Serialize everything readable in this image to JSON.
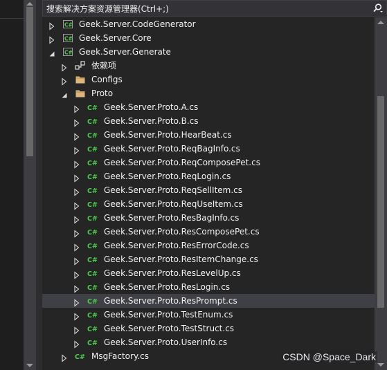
{
  "search": {
    "placeholder": "搜索解决方案资源管理器(Ctrl+;)"
  },
  "tree": [
    {
      "label": "Geek.Server.CodeGenerator",
      "icon": "csharp-project-icon",
      "level": 0,
      "expander": "collapsed"
    },
    {
      "label": "Geek.Server.Core",
      "icon": "csharp-project-icon",
      "level": 0,
      "expander": "collapsed"
    },
    {
      "label": "Geek.Server.Generate",
      "icon": "csharp-project-icon",
      "level": 0,
      "expander": "expanded"
    },
    {
      "label": "依赖项",
      "icon": "dependencies-icon",
      "level": 1,
      "expander": "collapsed"
    },
    {
      "label": "Configs",
      "icon": "folder-icon",
      "level": 1,
      "expander": "collapsed"
    },
    {
      "label": "Proto",
      "icon": "folder-icon",
      "level": 1,
      "expander": "expanded"
    },
    {
      "label": "Geek.Server.Proto.A.cs",
      "icon": "csharp-file-icon",
      "level": 2,
      "expander": "collapsed"
    },
    {
      "label": "Geek.Server.Proto.B.cs",
      "icon": "csharp-file-icon",
      "level": 2,
      "expander": "collapsed"
    },
    {
      "label": "Geek.Server.Proto.HearBeat.cs",
      "icon": "csharp-file-icon",
      "level": 2,
      "expander": "collapsed"
    },
    {
      "label": "Geek.Server.Proto.ReqBagInfo.cs",
      "icon": "csharp-file-icon",
      "level": 2,
      "expander": "collapsed"
    },
    {
      "label": "Geek.Server.Proto.ReqComposePet.cs",
      "icon": "csharp-file-icon",
      "level": 2,
      "expander": "collapsed"
    },
    {
      "label": "Geek.Server.Proto.ReqLogin.cs",
      "icon": "csharp-file-icon",
      "level": 2,
      "expander": "collapsed"
    },
    {
      "label": "Geek.Server.Proto.ReqSellItem.cs",
      "icon": "csharp-file-icon",
      "level": 2,
      "expander": "collapsed"
    },
    {
      "label": "Geek.Server.Proto.ReqUseItem.cs",
      "icon": "csharp-file-icon",
      "level": 2,
      "expander": "collapsed"
    },
    {
      "label": "Geek.Server.Proto.ResBagInfo.cs",
      "icon": "csharp-file-icon",
      "level": 2,
      "expander": "collapsed"
    },
    {
      "label": "Geek.Server.Proto.ResComposePet.cs",
      "icon": "csharp-file-icon",
      "level": 2,
      "expander": "collapsed"
    },
    {
      "label": "Geek.Server.Proto.ResErrorCode.cs",
      "icon": "csharp-file-icon",
      "level": 2,
      "expander": "collapsed"
    },
    {
      "label": "Geek.Server.Proto.ResItemChange.cs",
      "icon": "csharp-file-icon",
      "level": 2,
      "expander": "collapsed"
    },
    {
      "label": "Geek.Server.Proto.ResLevelUp.cs",
      "icon": "csharp-file-icon",
      "level": 2,
      "expander": "collapsed"
    },
    {
      "label": "Geek.Server.Proto.ResLogin.cs",
      "icon": "csharp-file-icon",
      "level": 2,
      "expander": "collapsed"
    },
    {
      "label": "Geek.Server.Proto.ResPrompt.cs",
      "icon": "csharp-file-icon",
      "level": 2,
      "expander": "collapsed",
      "selected": true
    },
    {
      "label": "Geek.Server.Proto.TestEnum.cs",
      "icon": "csharp-file-icon",
      "level": 2,
      "expander": "collapsed"
    },
    {
      "label": "Geek.Server.Proto.TestStruct.cs",
      "icon": "csharp-file-icon",
      "level": 2,
      "expander": "collapsed"
    },
    {
      "label": "Geek.Server.Proto.UserInfo.cs",
      "icon": "csharp-file-icon",
      "level": 2,
      "expander": "collapsed"
    },
    {
      "label": "MsgFactory.cs",
      "icon": "csharp-file-icon",
      "level": 1,
      "expander": "collapsed"
    }
  ],
  "watermark": "CSDN @Space_Dark",
  "colors": {
    "background": "#252526",
    "selected_row": "#3f3f46",
    "csharp_green": "#4ec94e",
    "folder": "#dcb67a",
    "text": "#f1f1f1"
  }
}
